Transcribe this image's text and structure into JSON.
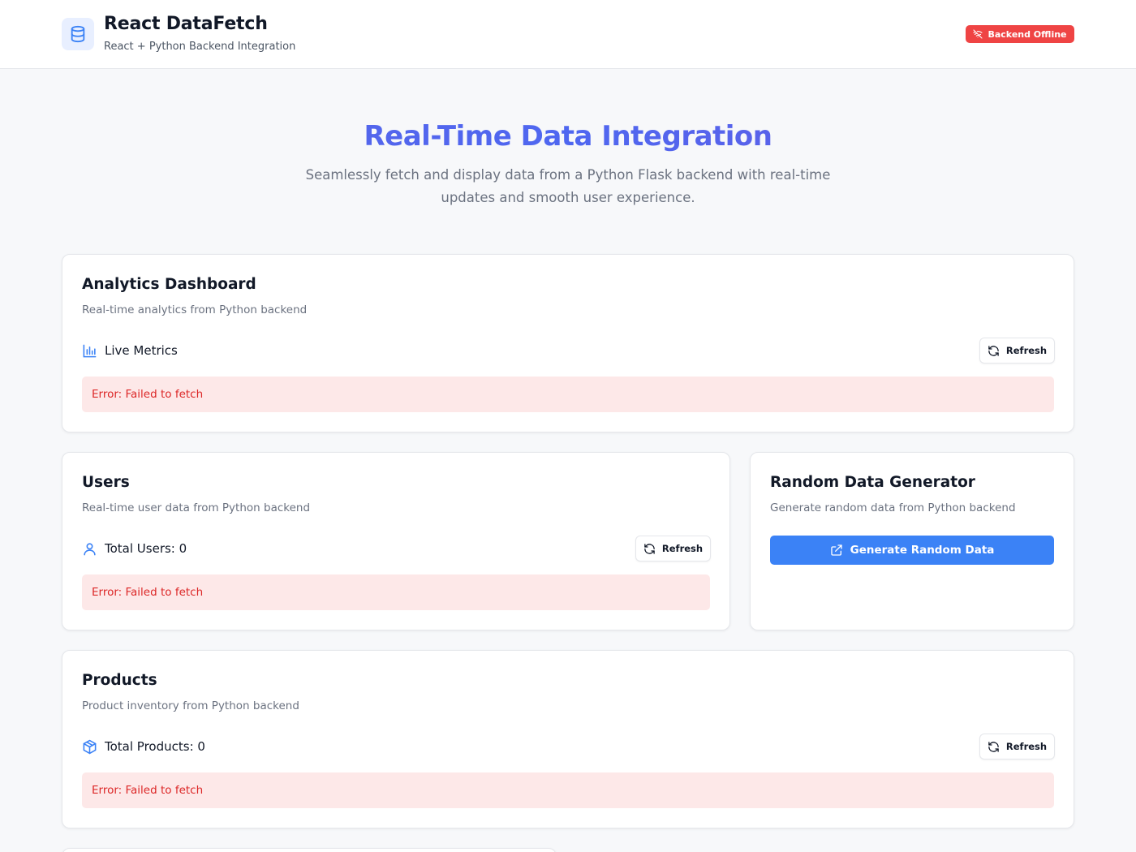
{
  "header": {
    "title": "React DataFetch",
    "subtitle": "React + Python Backend Integration",
    "status_badge": "Backend Offline"
  },
  "hero": {
    "title": "Real-Time Data Integration",
    "subtitle": "Seamlessly fetch and display data from a Python Flask backend with real-time updates and smooth user experience."
  },
  "analytics": {
    "title": "Analytics Dashboard",
    "description": "Real-time analytics from Python backend",
    "metric_label": "Live Metrics",
    "refresh_label": "Refresh",
    "error": "Error: Failed to fetch"
  },
  "users": {
    "title": "Users",
    "description": "Real-time user data from Python backend",
    "metric_label": "Total Users: 0",
    "refresh_label": "Refresh",
    "error": "Error: Failed to fetch"
  },
  "random": {
    "title": "Random Data Generator",
    "description": "Generate random data from Python backend",
    "button_label": "Generate Random Data"
  },
  "products": {
    "title": "Products",
    "description": "Product inventory from Python backend",
    "metric_label": "Total Products: 0",
    "refresh_label": "Refresh",
    "error": "Error: Failed to fetch"
  },
  "colors": {
    "accent": "#3b82f6",
    "hero_gradient": "#5b63e6",
    "error_text": "#dc2626",
    "error_bg": "#fde8e8",
    "badge_offline": "#ef4444"
  }
}
